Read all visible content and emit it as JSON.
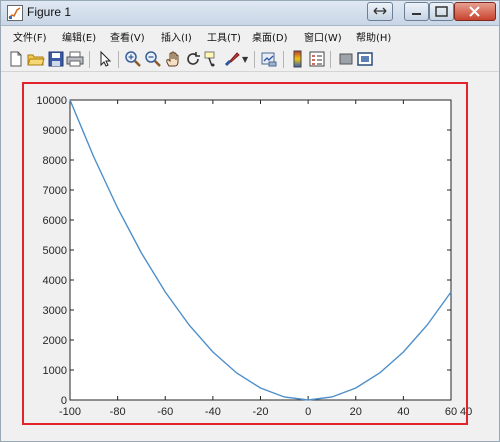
{
  "window": {
    "title": "Figure 1"
  },
  "menu": {
    "items": [
      {
        "label": "文件(F)"
      },
      {
        "label": "编辑(E)"
      },
      {
        "label": "查看(V)"
      },
      {
        "label": "插入(I)"
      },
      {
        "label": "工具(T)"
      },
      {
        "label": "桌面(D)"
      },
      {
        "label": "窗口(W)"
      },
      {
        "label": "帮助(H)"
      }
    ]
  },
  "toolbar": {
    "icons": [
      "new-figure-icon",
      "open-file-icon",
      "save-icon",
      "print-icon",
      "select-arrow-icon",
      "zoom-in-icon",
      "zoom-out-icon",
      "pan-hand-icon",
      "rotate-3d-icon",
      "data-cursor-icon",
      "brush-icon",
      "link-plot-icon",
      "colorbar-icon",
      "legend-icon",
      "hide-plot-tools-icon",
      "show-plot-tools-icon"
    ]
  },
  "colors": {
    "line": "#4f8fc9",
    "highlight_frame": "#e3232c",
    "axes_background": "#ffffff"
  },
  "chart_data": {
    "type": "line",
    "title": "",
    "xlabel": "",
    "ylabel": "",
    "xlim": [
      -100,
      60
    ],
    "ylim": [
      0,
      10000
    ],
    "x_ticks": [
      -100,
      -80,
      -60,
      -40,
      -20,
      0,
      20,
      40,
      60
    ],
    "y_ticks": [
      0,
      1000,
      2000,
      3000,
      4000,
      5000,
      6000,
      7000,
      8000,
      9000,
      10000
    ],
    "x_tick_labels": [
      "-100",
      "-80",
      "-60",
      "-40",
      "-20",
      "0",
      "20",
      "40",
      "60"
    ],
    "y_tick_labels": [
      "0",
      "1000",
      "2000",
      "3000",
      "4000",
      "5000",
      "6000",
      "7000",
      "8000",
      "9000",
      "10000"
    ],
    "stray_tick_label": "40",
    "grid": false,
    "series": [
      {
        "x": [
          -100,
          -90,
          -80,
          -70,
          -60,
          -50,
          -40,
          -30,
          -20,
          -10,
          0,
          10,
          20,
          30,
          40,
          50,
          60
        ],
        "y": [
          10000,
          8100,
          6400,
          4900,
          3600,
          2500,
          1600,
          900,
          400,
          100,
          0,
          100,
          400,
          900,
          1600,
          2500,
          3600
        ]
      }
    ]
  }
}
